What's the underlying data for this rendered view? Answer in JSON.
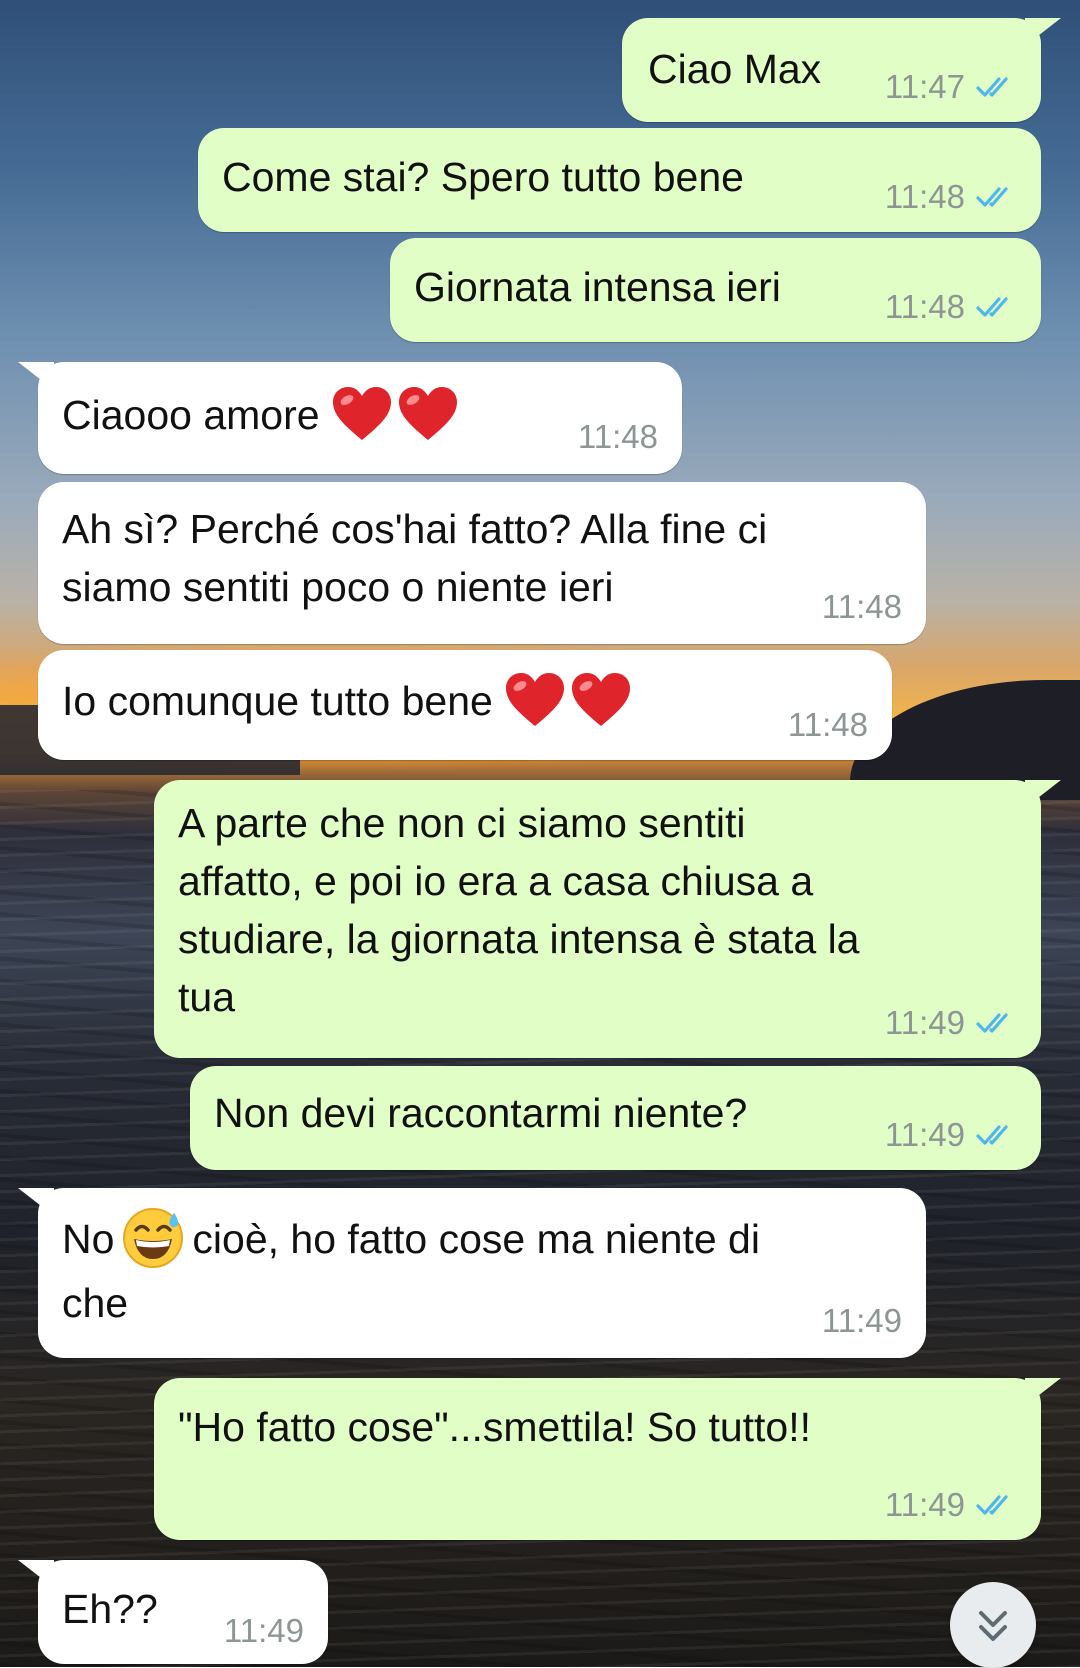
{
  "theme": {
    "outgoing_bubble": "#e1fec6",
    "incoming_bubble": "#ffffff",
    "read_tick": "#4fb6ec",
    "timestamp": "#8e9694"
  },
  "messages": [
    {
      "direction": "outgoing",
      "text": "Ciao Max",
      "time": "11:47",
      "status": "read"
    },
    {
      "direction": "outgoing",
      "text": "Come stai? Spero tutto bene",
      "time": "11:48",
      "status": "read"
    },
    {
      "direction": "outgoing",
      "text": "Giornata intensa ieri",
      "time": "11:48",
      "status": "read"
    },
    {
      "direction": "incoming",
      "text": "Ciaooo amore",
      "emoji": [
        "red-heart",
        "red-heart"
      ],
      "time": "11:48"
    },
    {
      "direction": "incoming",
      "lines": [
        "Ah sì? Perché cos'hai fatto? Alla fine ci",
        "siamo sentiti poco o niente ieri"
      ],
      "time": "11:48"
    },
    {
      "direction": "incoming",
      "text": "Io comunque tutto bene",
      "emoji": [
        "red-heart",
        "red-heart"
      ],
      "time": "11:48"
    },
    {
      "direction": "outgoing",
      "lines": [
        "A parte che non ci siamo sentiti",
        "affatto, e poi io era a casa chiusa a",
        "studiare, la giornata intensa è stata la",
        "tua"
      ],
      "time": "11:49",
      "status": "read"
    },
    {
      "direction": "outgoing",
      "text": "Non devi raccontarmi niente?",
      "time": "11:49",
      "status": "read"
    },
    {
      "direction": "incoming",
      "before_emoji": "No",
      "emoji": [
        "grinning-face-with-sweat"
      ],
      "after_emoji": "cioè, ho fatto cose ma niente di",
      "second_line": "che",
      "time": "11:49"
    },
    {
      "direction": "outgoing",
      "text": "\"Ho fatto cose\"...smettila! So tutto!!",
      "time": "11:49",
      "status": "read"
    },
    {
      "direction": "incoming",
      "text": "Eh??",
      "time": "11:49"
    }
  ],
  "scroll_to_bottom": {
    "icon": "double-chevron-down-icon"
  }
}
